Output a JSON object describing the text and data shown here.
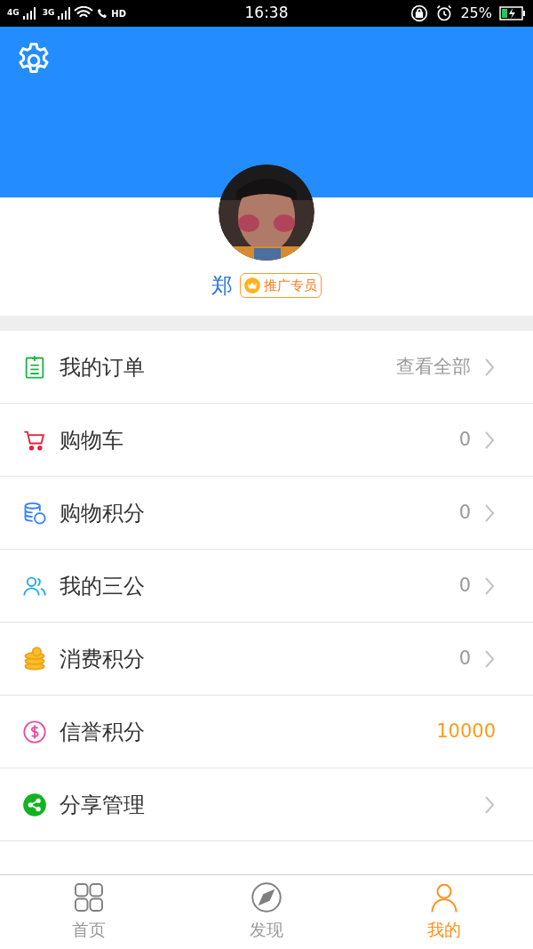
{
  "status_bar": {
    "network_1": "4G",
    "network_2": "3G",
    "call": "HD",
    "time": "16:38",
    "battery": "25%"
  },
  "profile": {
    "name": "郑",
    "badge": "推广专员"
  },
  "menu": [
    {
      "label": "我的订单",
      "kind": "link",
      "value": "查看全部"
    },
    {
      "label": "购物车",
      "kind": "count",
      "value": "0"
    },
    {
      "label": "购物积分",
      "kind": "count",
      "value": "0"
    },
    {
      "label": "我的三公",
      "kind": "count",
      "value": "0"
    },
    {
      "label": "消费积分",
      "kind": "count",
      "value": "0"
    },
    {
      "label": "信誉积分",
      "kind": "score",
      "value": "10000"
    },
    {
      "label": "分享管理",
      "kind": "link"
    }
  ],
  "tab_bar": [
    {
      "label": "首页",
      "selected": false
    },
    {
      "label": "发现",
      "selected": false
    },
    {
      "label": "我的",
      "selected": true
    }
  ]
}
